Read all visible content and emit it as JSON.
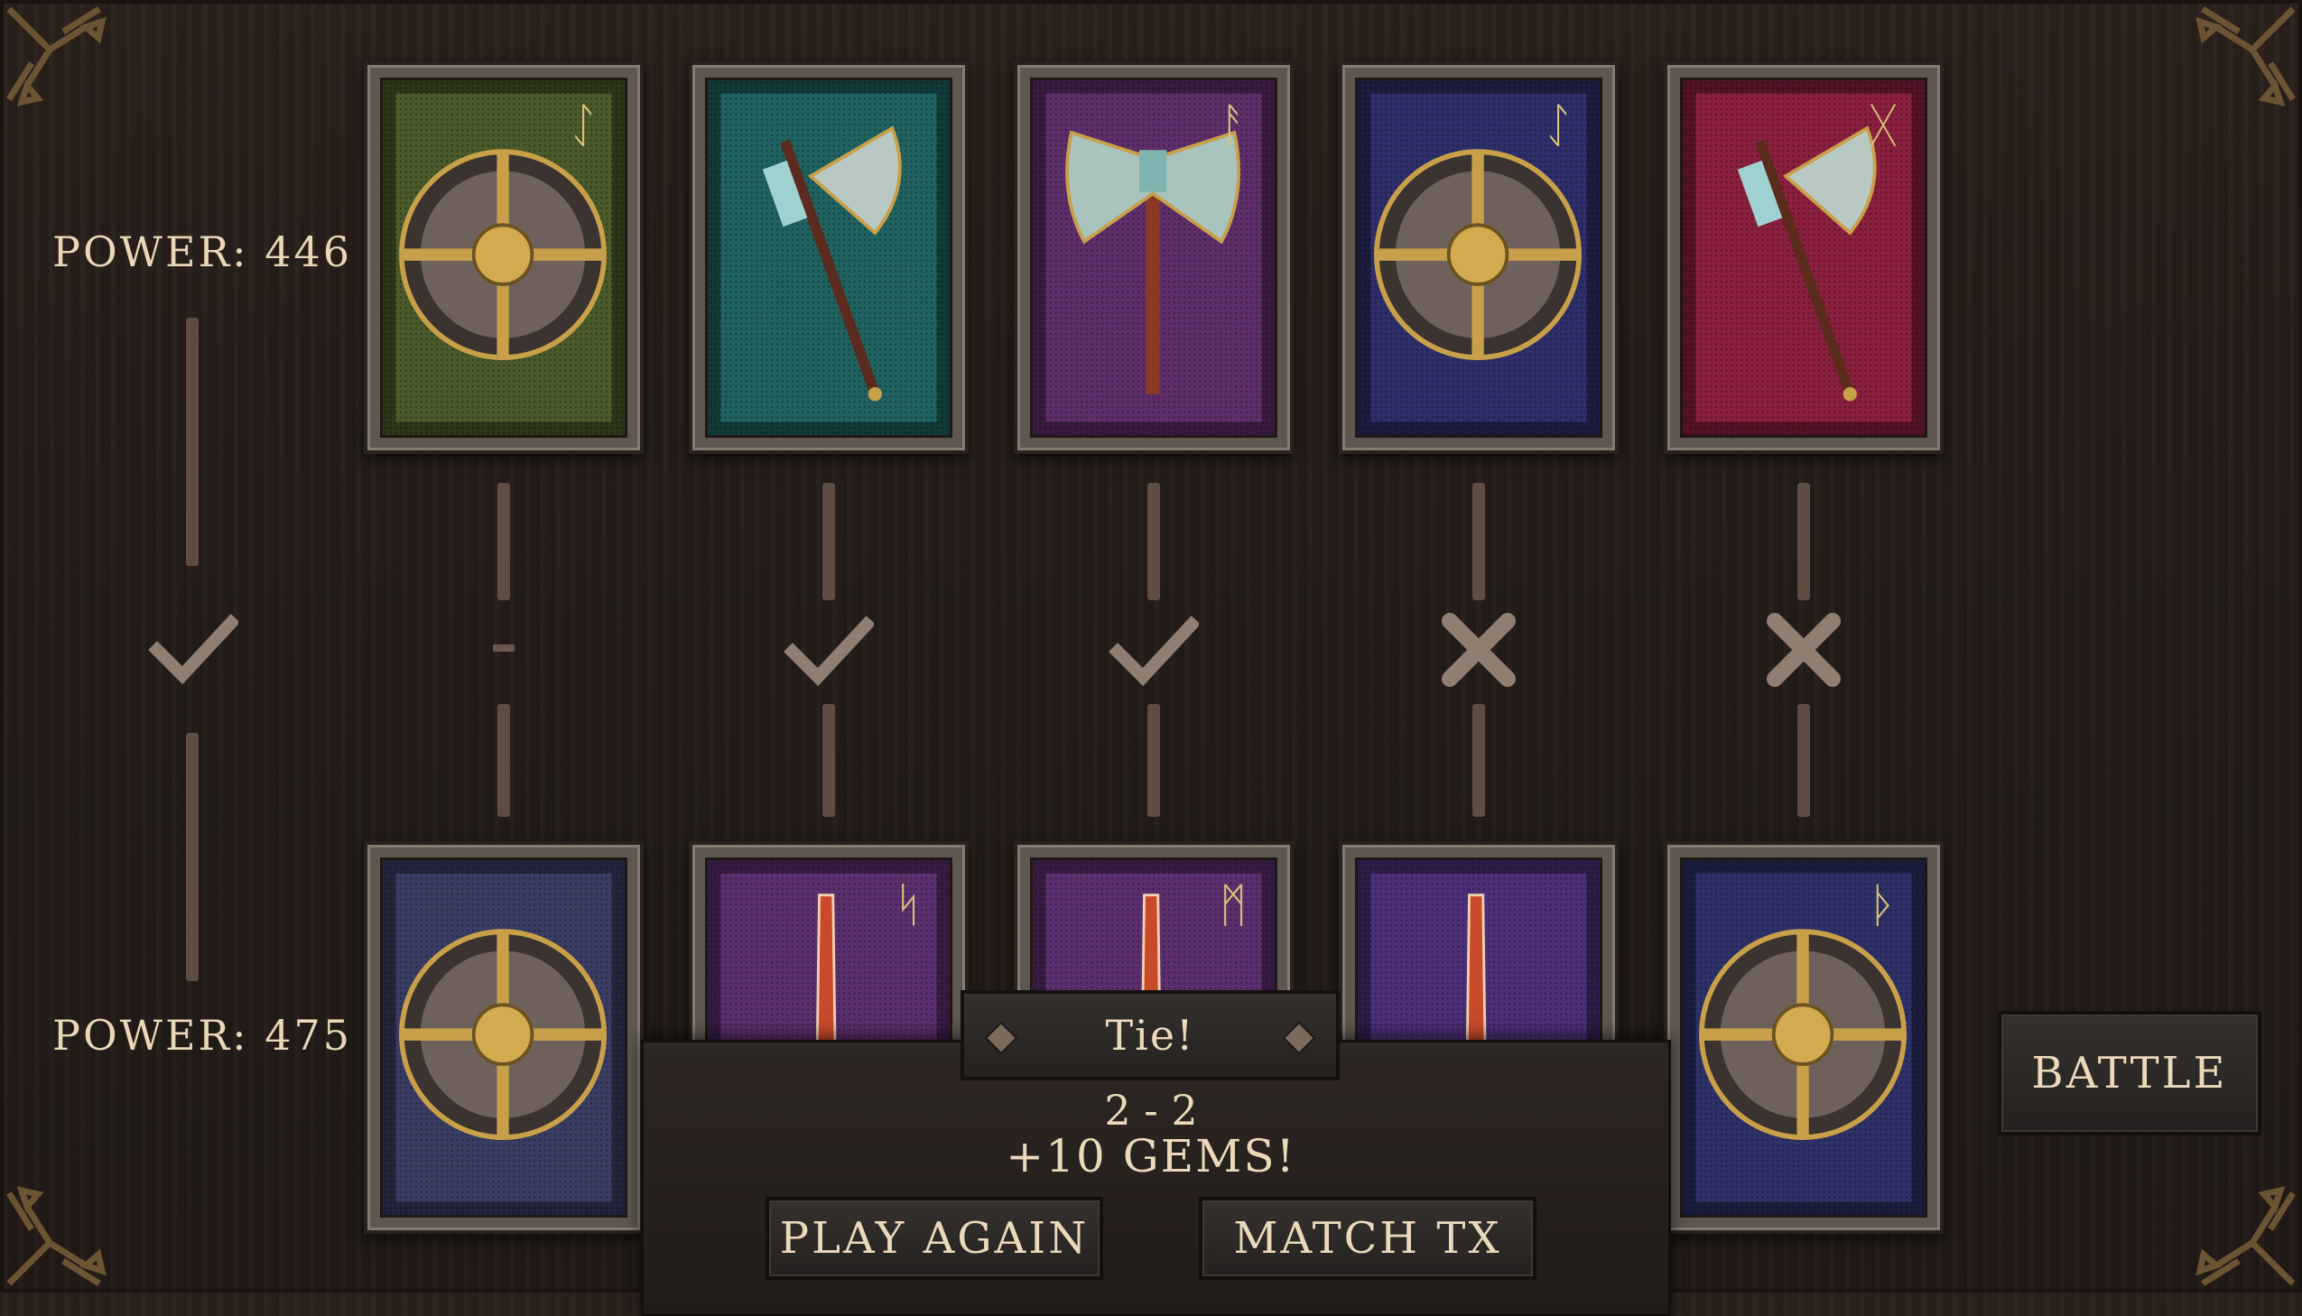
{
  "player": {
    "power_label": "POWER: 446"
  },
  "opponent": {
    "power_label": "POWER: 475"
  },
  "overall_result": "win",
  "rounds": [
    {
      "result": "tie"
    },
    {
      "result": "win"
    },
    {
      "result": "win"
    },
    {
      "result": "loss"
    },
    {
      "result": "loss"
    }
  ],
  "top_cards": [
    {
      "name": "round-shield",
      "bg": "#4a5a2a",
      "rune": "ᛇ"
    },
    {
      "name": "axe",
      "bg": "#1f6260",
      "rune": ""
    },
    {
      "name": "double-axe",
      "bg": "#5e2e6a",
      "rune": "ᚨ"
    },
    {
      "name": "round-shield",
      "bg": "#2e2f6a",
      "rune": "ᛇ"
    },
    {
      "name": "axe",
      "bg": "#8b1f3e",
      "rune": "ᚷ"
    }
  ],
  "bottom_cards": [
    {
      "name": "round-shield",
      "bg": "#3a3d63",
      "rune": ""
    },
    {
      "name": "sword",
      "bg": "#5b2f6e",
      "rune": "ᛋ"
    },
    {
      "name": "sword",
      "bg": "#5b2f6e",
      "rune": "ᛗ"
    },
    {
      "name": "sword",
      "bg": "#4b2f78",
      "rune": ""
    },
    {
      "name": "round-shield",
      "bg": "#2e3168",
      "rune": "ᚦ"
    }
  ],
  "result_panel": {
    "title": "Tie!",
    "score": "2 - 2",
    "reward": "+10 GEMS!",
    "play_again_label": "PLAY AGAIN",
    "match_tx_label": "MATCH TX"
  },
  "battle_label": "BATTLE",
  "colors": {
    "text": "#e6d2b4",
    "background": "#261e1a",
    "marks": "#8f7f72"
  }
}
